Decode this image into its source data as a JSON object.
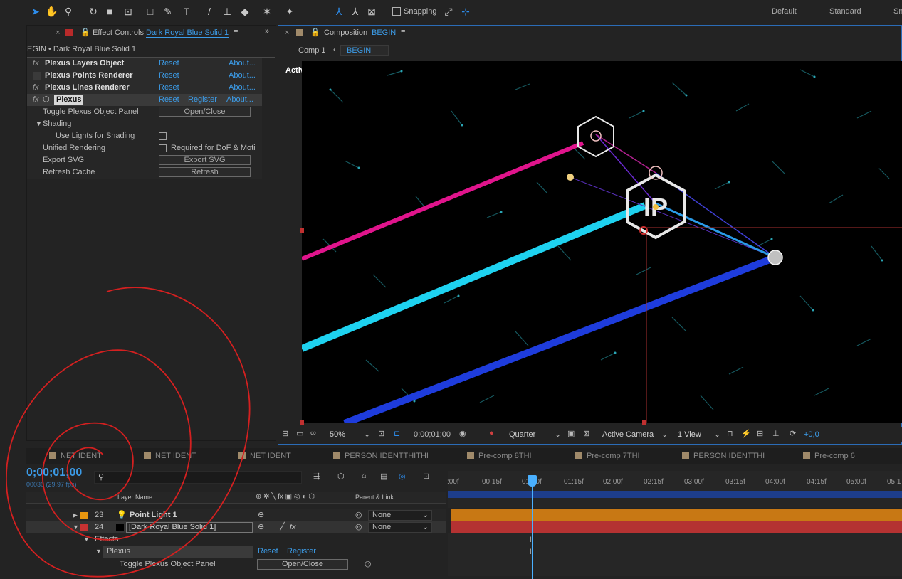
{
  "toolbar": {
    "snapping_label": "Snapping",
    "workspaces": [
      "Default",
      "Standard",
      "Sm"
    ]
  },
  "effect_controls": {
    "panel_title": "Effect Controls",
    "layer_name": "Dark Royal Blue Solid 1",
    "breadcrumb": "EGIN • Dark Royal Blue Solid 1",
    "effects": [
      {
        "name": "Plexus Layers Object",
        "reset": "Reset",
        "about": "About..."
      },
      {
        "name": "Plexus Points Renderer",
        "reset": "Reset",
        "about": "About..."
      },
      {
        "name": "Plexus Lines Renderer",
        "reset": "Reset",
        "about": "About..."
      },
      {
        "name": "Plexus",
        "reset": "Reset",
        "register": "Register",
        "about": "About..."
      }
    ],
    "props": {
      "toggle_panel": "Toggle Plexus Object Panel",
      "open_close": "Open/Close",
      "shading": "Shading",
      "use_lights": "Use Lights for Shading",
      "unified_rendering": "Unified Rendering",
      "required_dof": "Required for DoF & Moti",
      "export_svg": "Export SVG",
      "export_svg_btn": "Export SVG",
      "refresh_cache": "Refresh Cache",
      "refresh_btn": "Refresh"
    }
  },
  "composition": {
    "panel_title": "Composition",
    "comp_name": "BEGIN",
    "breadcrumb_parent": "Comp 1",
    "breadcrumb_current": "BEGIN",
    "camera_label": "Active Camera",
    "footer": {
      "zoom": "50%",
      "timecode": "0;00;01;00",
      "resolution": "Quarter",
      "camera": "Active Camera",
      "views": "1 View",
      "exposure": "+0,0"
    }
  },
  "timeline_tabs": [
    {
      "label": "NET IDENT",
      "color": "#a08a6a"
    },
    {
      "label": "NET IDENT",
      "color": "#a08a6a"
    },
    {
      "label": "NET IDENT",
      "color": "#a08a6a"
    },
    {
      "label": "PERSON IDENTTHITHI",
      "color": "#a08a6a"
    },
    {
      "label": "Pre-comp 8THI",
      "color": "#a08a6a"
    },
    {
      "label": "Pre-comp 7THI",
      "color": "#a08a6a"
    },
    {
      "label": "PERSON IDENTTHI",
      "color": "#a08a6a"
    },
    {
      "label": "Pre-comp 6",
      "color": "#a08a6a"
    }
  ],
  "timeline": {
    "timecode": "0;00;01;00",
    "fps": "00030 (29.97 fps)",
    "col_layer_name": "Layer Name",
    "col_parent": "Parent & Link",
    "ruler": [
      ":00f",
      "00:15f",
      "01:00f",
      "01:15f",
      "02:00f",
      "02:15f",
      "03:00f",
      "03:15f",
      "04:00f",
      "04:15f",
      "05:00f",
      "05:1"
    ],
    "layers": [
      {
        "num": "23",
        "name": "Point Light 1",
        "parent": "None",
        "color": "#e8960f"
      },
      {
        "num": "24",
        "name": "[Dark Royal Blue Solid 1]",
        "parent": "None",
        "color": "#c83232"
      }
    ],
    "effects_label": "Effects",
    "plexus_label": "Plexus",
    "plexus_reset": "Reset",
    "plexus_register": "Register",
    "toggle_label": "Toggle Plexus Object Panel",
    "open_close": "Open/Close"
  },
  "colors": {
    "accent": "#2d8ceb",
    "magenta_line": "#e0148c",
    "cyan_line": "#1ed2f0",
    "blue_line": "#1e3cdc",
    "orange_track": "#c87814",
    "red_track": "#b43232"
  }
}
